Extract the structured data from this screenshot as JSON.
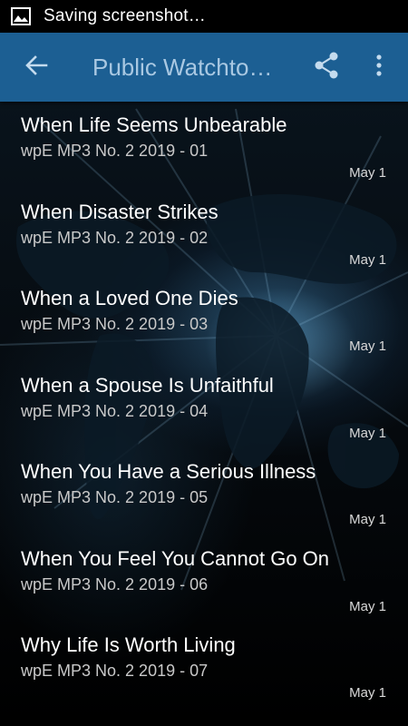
{
  "status_bar": {
    "icon": "image-icon",
    "text": "Saving screenshot…"
  },
  "app_bar": {
    "title": "Public Watchto…",
    "back_icon": "arrow-left-icon",
    "share_icon": "share-icon",
    "overflow_icon": "more-vertical-icon",
    "color": "#1c5f93"
  },
  "items": [
    {
      "title": "When Life Seems Unbearable",
      "subtitle": "wpE MP3 No. 2 2019 - 01",
      "date": "May 1"
    },
    {
      "title": "When Disaster Strikes",
      "subtitle": "wpE MP3 No. 2 2019 - 02",
      "date": "May 1"
    },
    {
      "title": "When a Loved One Dies",
      "subtitle": "wpE MP3 No. 2 2019 - 03",
      "date": "May 1"
    },
    {
      "title": "When a Spouse Is Unfaithful",
      "subtitle": "wpE MP3 No. 2 2019 - 04",
      "date": "May 1"
    },
    {
      "title": "When You Have a Serious Illness",
      "subtitle": "wpE MP3 No. 2 2019 - 05",
      "date": "May 1"
    },
    {
      "title": "When You Feel You Cannot Go On",
      "subtitle": "wpE MP3 No. 2 2019 - 06",
      "date": "May 1"
    },
    {
      "title": "Why Life Is Worth Living",
      "subtitle": "wpE MP3 No. 2 2019 - 07",
      "date": "May 1"
    }
  ]
}
